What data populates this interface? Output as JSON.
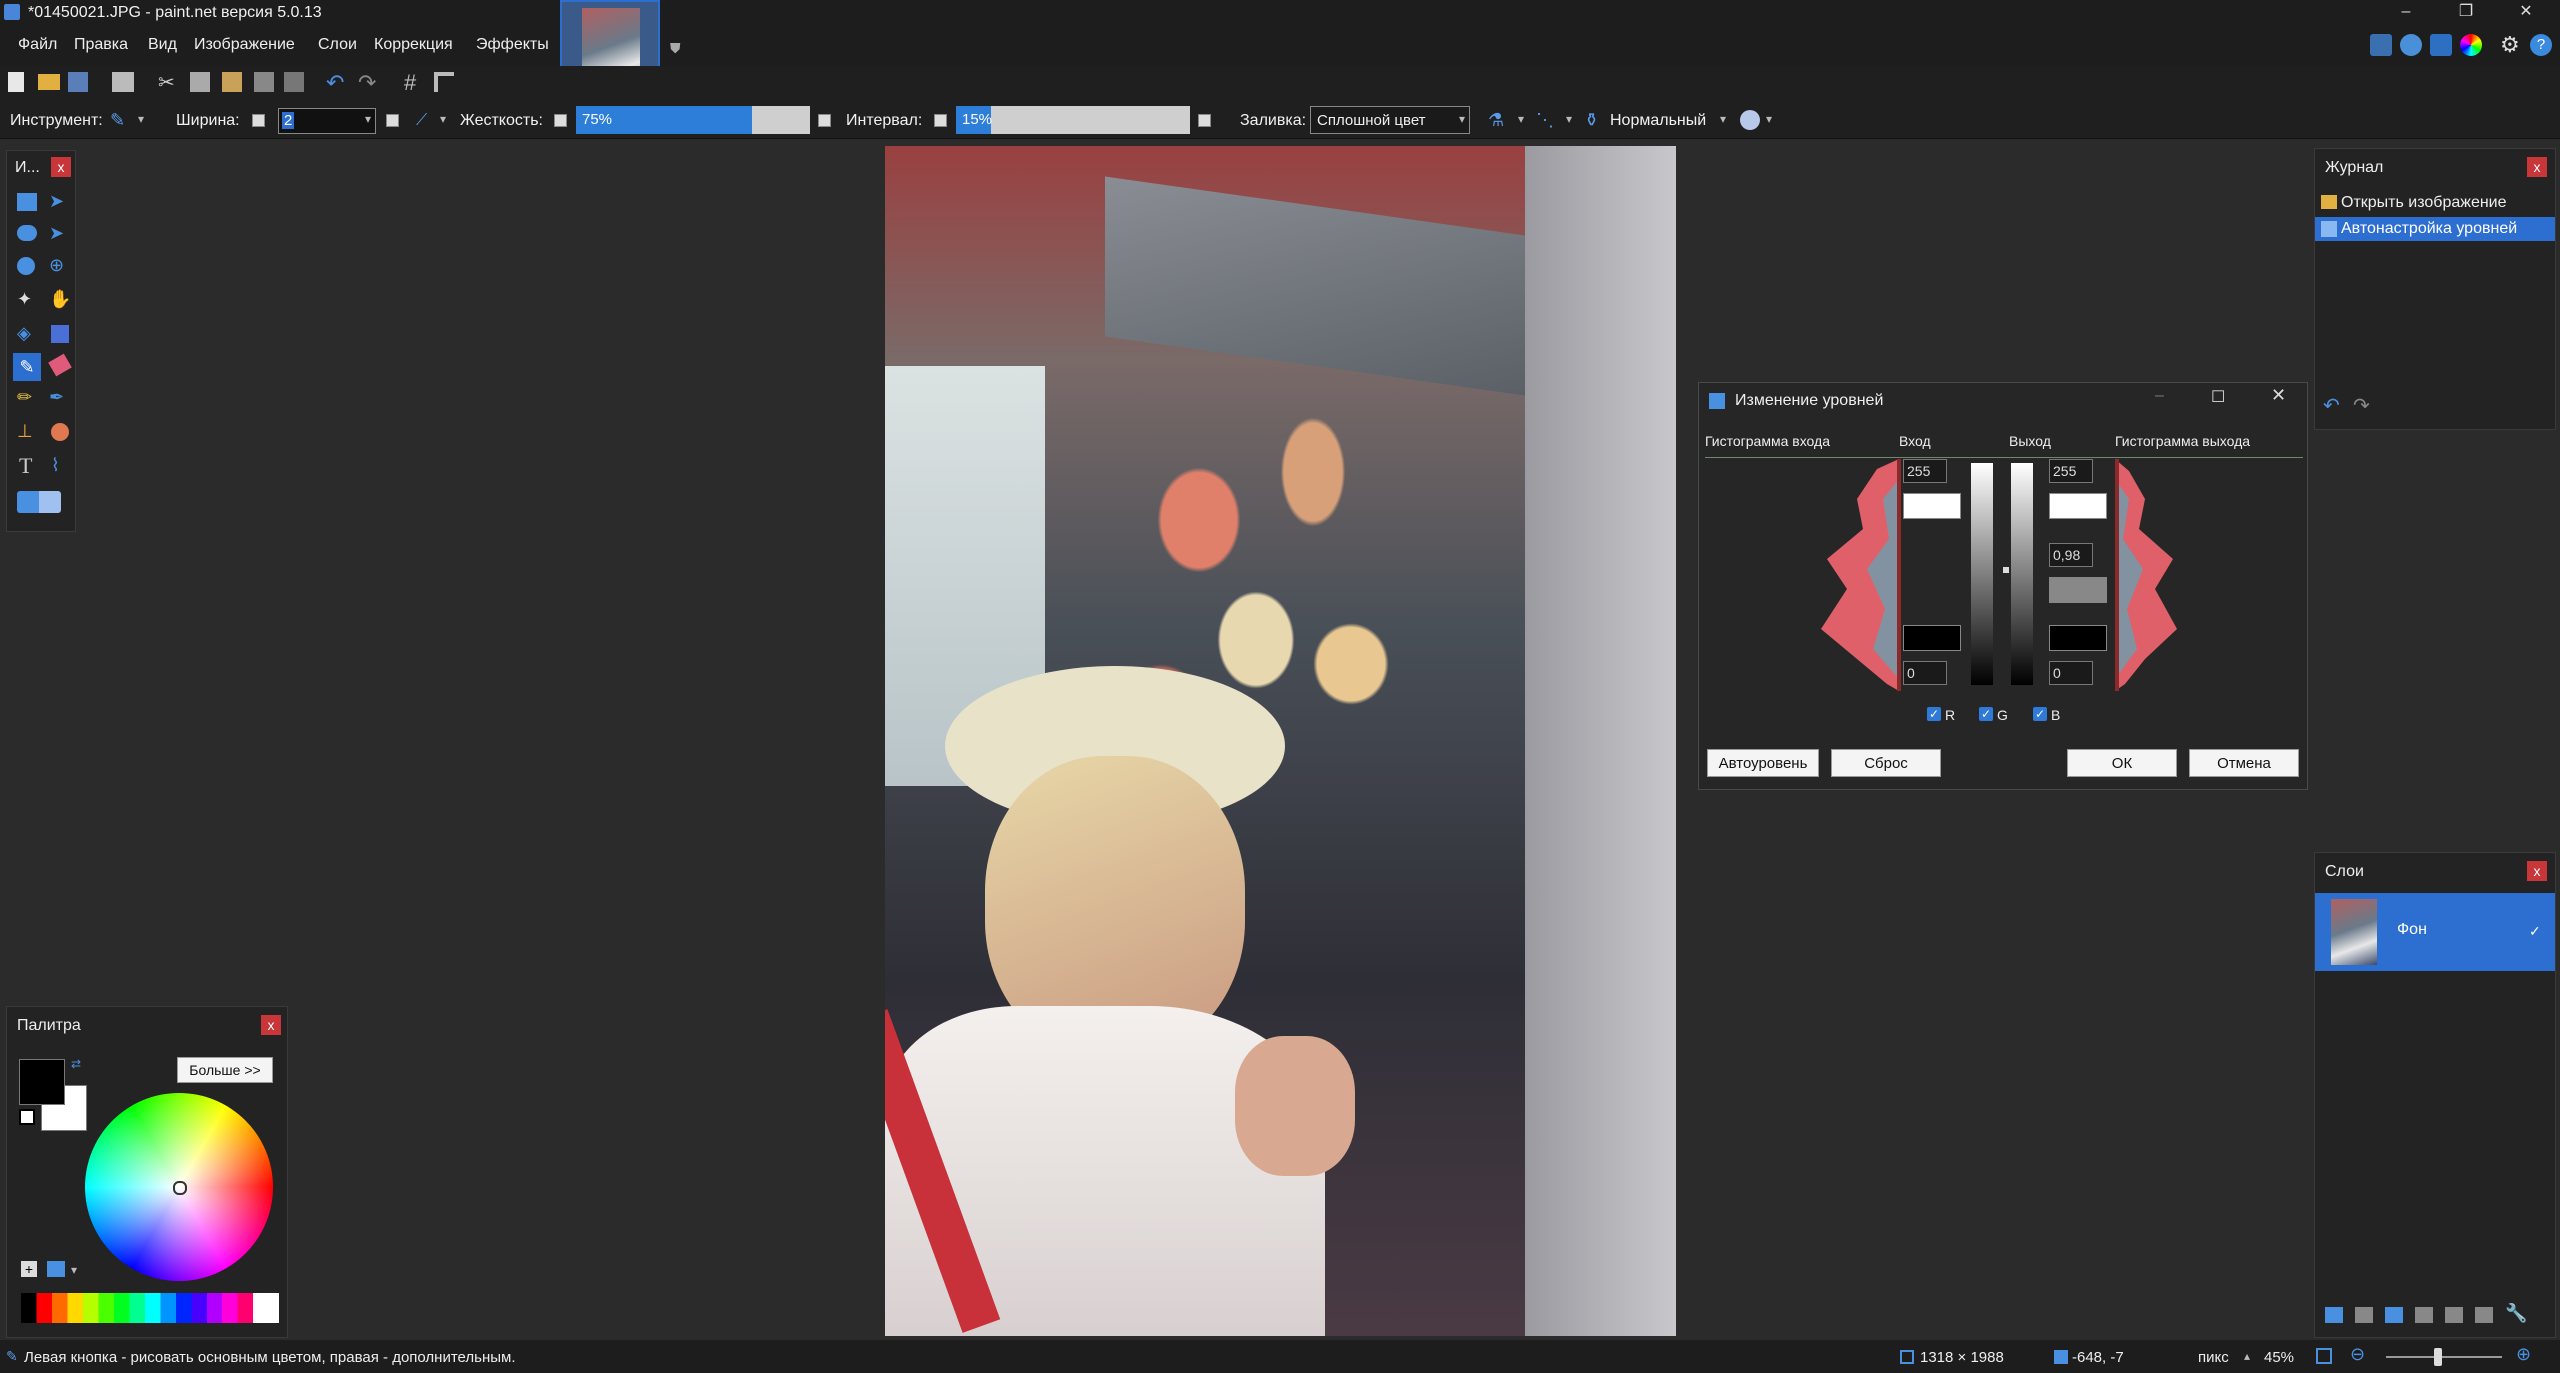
{
  "window": {
    "title": "*01450021.JPG - paint.net версия 5.0.13",
    "minimize": "–",
    "maximize": "❐",
    "close": "✕"
  },
  "menu": [
    "Файл",
    "Правка",
    "Вид",
    "Изображение",
    "Слои",
    "Коррекция",
    "Эффекты"
  ],
  "toolbar": {
    "tool_label": "Инструмент:",
    "width_label": "Ширина:",
    "width_value": "2",
    "hardness_label": "Жесткость:",
    "hardness_value": "75%",
    "hardness_fraction": 0.75,
    "interval_label": "Интервал:",
    "interval_value": "15%",
    "interval_fraction": 0.15,
    "fill_label": "Заливка:",
    "fill_value": "Сплошной цвет",
    "blend_value": "Нормальный"
  },
  "tools_panel": {
    "title": "И..."
  },
  "palette": {
    "title": "Палитра",
    "more_button": "Больше >>",
    "primary_color": "#000000",
    "secondary_color": "#ffffff"
  },
  "history": {
    "title": "Журнал",
    "items": [
      "Открыть изображение",
      "Автонастройка уровней"
    ]
  },
  "layers": {
    "title": "Слои",
    "items": [
      {
        "name": "Фон"
      }
    ]
  },
  "levels_dialog": {
    "title": "Изменение уровней",
    "input_hist_label": "Гистограмма входа",
    "input_label": "Вход",
    "output_label": "Выход",
    "output_hist_label": "Гистограмма выхода",
    "input_high": "255",
    "input_low": "0",
    "output_high": "255",
    "output_gamma": "0,98",
    "output_low": "0",
    "channels": [
      "R",
      "G",
      "B"
    ],
    "auto_button": "Автоуровень",
    "reset_button": "Сброс",
    "ok_button": "ОК",
    "cancel_button": "Отмена"
  },
  "status": {
    "hint": "Левая кнопка - рисовать основным цветом, правая - дополнительным.",
    "image_size": "1318 × 1988",
    "cursor_pos": "-648, -7",
    "units": "пикс",
    "zoom": "45%"
  },
  "colors": {
    "accent": "#2c6fd0",
    "close_red": "#c8363a",
    "hist_red": "#e0606a"
  }
}
